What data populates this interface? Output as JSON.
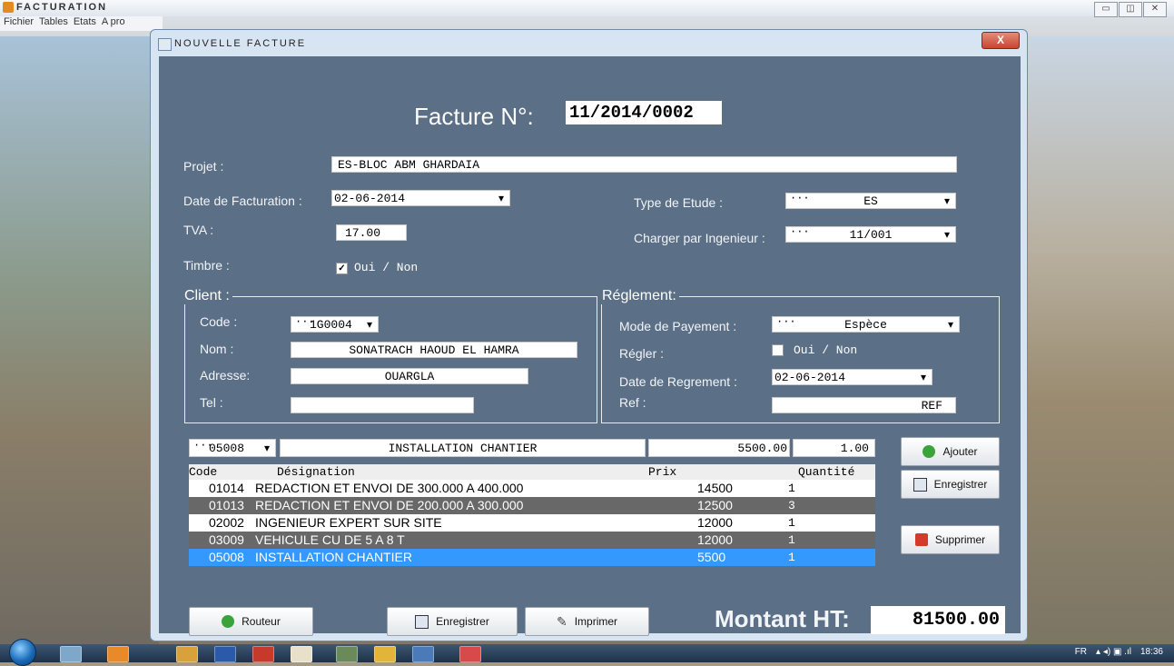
{
  "app": {
    "title": "FACTURATION",
    "menu": [
      "Fichier",
      "Tables",
      "Etats",
      "A pro"
    ]
  },
  "dialog": {
    "title": "NOUVELLE FACTURE",
    "close_label": "X",
    "heading": "Facture N°:",
    "facture_no": "11/2014/0002"
  },
  "form": {
    "projet_label": "Projet :",
    "projet_value": "ES-BLOC ABM GHARDAIA",
    "date_label": "Date de Facturation :",
    "date_value": "02-06-2014",
    "tva_label": "TVA :",
    "tva_value": "17.00",
    "timbre_label": "Timbre :",
    "timbre_check": "Oui / Non",
    "type_label": "Type de Etude :",
    "type_value": "ES",
    "charger_label": "Charger par Ingenieur :",
    "charger_value": "11/001"
  },
  "client": {
    "title": "Client :",
    "code_label": "Code :",
    "code_value": "1G0004",
    "nom_label": "Nom :",
    "nom_value": "SONATRACH HAOUD EL HAMRA",
    "adresse_label": "Adresse:",
    "adresse_value": "OUARGLA",
    "tel_label": "Tel :",
    "tel_value": ""
  },
  "reglement": {
    "title": "Réglement:",
    "mode_label": "Mode de Payement :",
    "mode_value": "Espèce",
    "regler_label": "Régler :",
    "regler_check": "Oui / Non",
    "date_label": "Date de Regrement :",
    "date_value": "02-06-2014",
    "ref_label": "Ref :",
    "ref_value": "REF"
  },
  "entry": {
    "code": "05008",
    "designation": "INSTALLATION CHANTIER",
    "prix": "5500.00",
    "quantite": "1.00"
  },
  "buttons": {
    "ajouter": "Ajouter",
    "enregistrer_side": "Enregistrer",
    "supprimer": "Supprimer",
    "routeur": "Routeur",
    "enregistrer": "Enregistrer",
    "imprimer": "Imprimer"
  },
  "table": {
    "headers": [
      "Code",
      "Désignation",
      "Prix",
      "Quantité"
    ],
    "rows": [
      {
        "code": "01014",
        "designation": "REDACTION ET ENVOI DE 300.000 A 400.000",
        "prix": "14500",
        "quantite": "1"
      },
      {
        "code": "01013",
        "designation": "REDACTION ET ENVOI DE 200.000  A 300.000",
        "prix": "12500",
        "quantite": "3"
      },
      {
        "code": "02002",
        "designation": "INGENIEUR EXPERT SUR SITE",
        "prix": "12000",
        "quantite": "1"
      },
      {
        "code": "03009",
        "designation": "VEHICULE CU DE 5 A 8 T",
        "prix": "12000",
        "quantite": "1"
      },
      {
        "code": "05008",
        "designation": "INSTALLATION CHANTIER",
        "prix": "5500",
        "quantite": "1"
      }
    ]
  },
  "total": {
    "label": "Montant  HT:",
    "value": "81500.00"
  },
  "taskbar": {
    "lang": "FR",
    "time": "18:36"
  },
  "colors": {
    "panel": "#5b6f87",
    "row_dark": "#686868",
    "row_selected": "#3399ff"
  }
}
